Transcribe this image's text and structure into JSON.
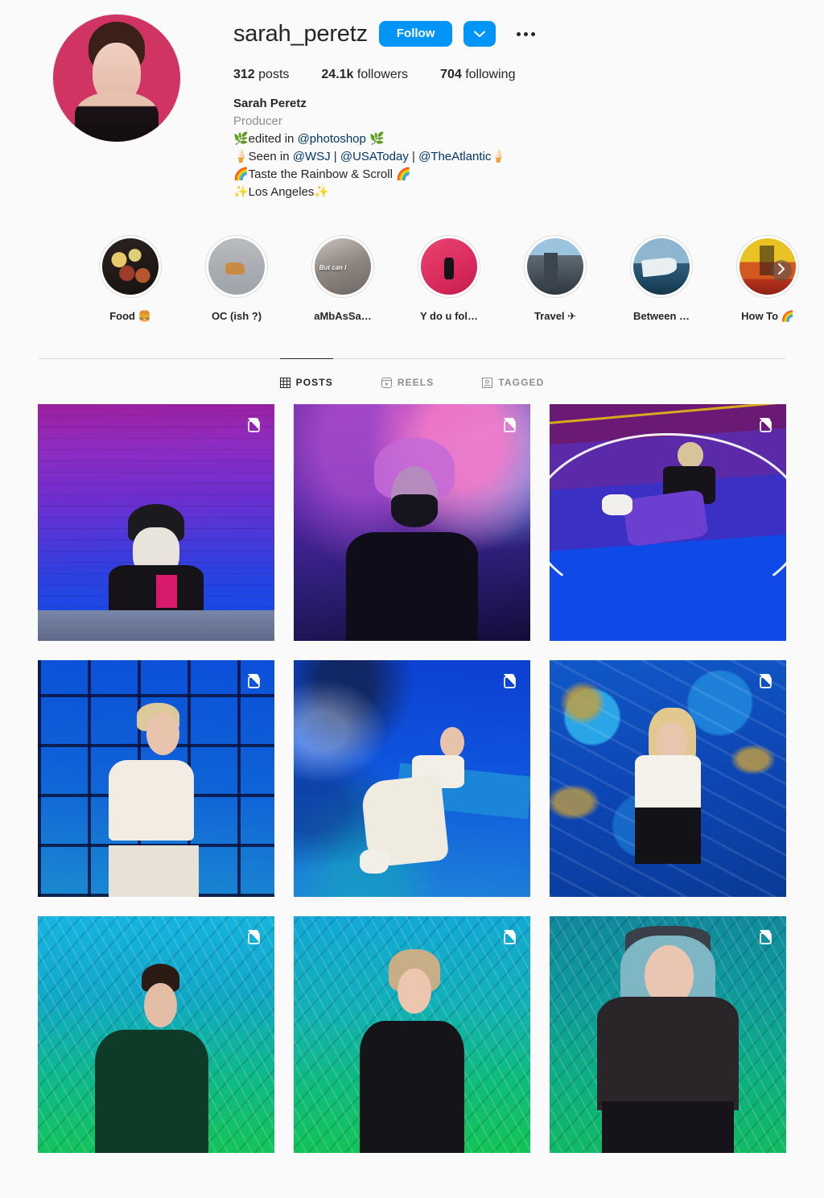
{
  "profile": {
    "username": "sarah_peretz",
    "follow_label": "Follow",
    "stats": {
      "posts_count": "312",
      "posts_label": "posts",
      "followers_count": "24.1k",
      "followers_label": "followers",
      "following_count": "704",
      "following_label": "following"
    },
    "full_name": "Sarah Peretz",
    "category": "Producer",
    "bio_lines": [
      "🌿edited in @photoshop 🌿",
      "🍦Seen in @WSJ | @USAToday | @TheAtlantic🍦",
      "🌈Taste the Rainbow & Scroll 🌈",
      "✨Los Angeles✨"
    ]
  },
  "highlights": [
    {
      "label": "Food 🍔",
      "cover": "cov-food"
    },
    {
      "label": "OC (ish ?)",
      "cover": "cov-oc"
    },
    {
      "label": "aMbAsSa…",
      "cover": "cov-amb"
    },
    {
      "label": "Y do u fol…",
      "cover": "cov-ydo"
    },
    {
      "label": "Travel ✈",
      "cover": "cov-travel"
    },
    {
      "label": "Between …",
      "cover": "cov-between"
    },
    {
      "label": "How To 🌈",
      "cover": "cov-howto"
    }
  ],
  "tabs": [
    {
      "label": "POSTS",
      "icon": "grid-icon",
      "active": true
    },
    {
      "label": "REELS",
      "icon": "reels-icon",
      "active": false
    },
    {
      "label": "TAGGED",
      "icon": "tagged-icon",
      "active": false
    }
  ],
  "grid": {
    "posts": [
      {
        "art": "art-1",
        "multi": true,
        "alt": "Woman in beanie seated against magenta-to-blue gradient garage door"
      },
      {
        "art": "art-2",
        "multi": true,
        "alt": "Neon purple portrait of woman wearing black face mask"
      },
      {
        "art": "art-3",
        "multi": true,
        "alt": "Woman posing on purple and blue basketball court"
      },
      {
        "art": "art-4",
        "multi": true,
        "alt": "Woman in white crop top against blue grid wall"
      },
      {
        "art": "art-5",
        "multi": true,
        "alt": "Woman in white dress amid blue liquid ink composite"
      },
      {
        "art": "art-6",
        "multi": true,
        "alt": "Woman in white tee and black shorts against blue graffiti wall"
      },
      {
        "art": "art-7",
        "multi": true,
        "alt": "Woman in dark green dress against cyan-green foil backdrop"
      },
      {
        "art": "art-8",
        "multi": true,
        "alt": "Woman blowing bubble against teal crystalline backdrop"
      },
      {
        "art": "art-9",
        "multi": true,
        "alt": "Blue-haired woman in black cut-out top against teal backdrop"
      }
    ]
  },
  "colors": {
    "accent": "#0095f6",
    "text_primary": "#262626",
    "text_secondary": "#8e8e8e",
    "link": "#00376b",
    "page_bg": "#fafafa",
    "divider": "#dbdbdb"
  }
}
